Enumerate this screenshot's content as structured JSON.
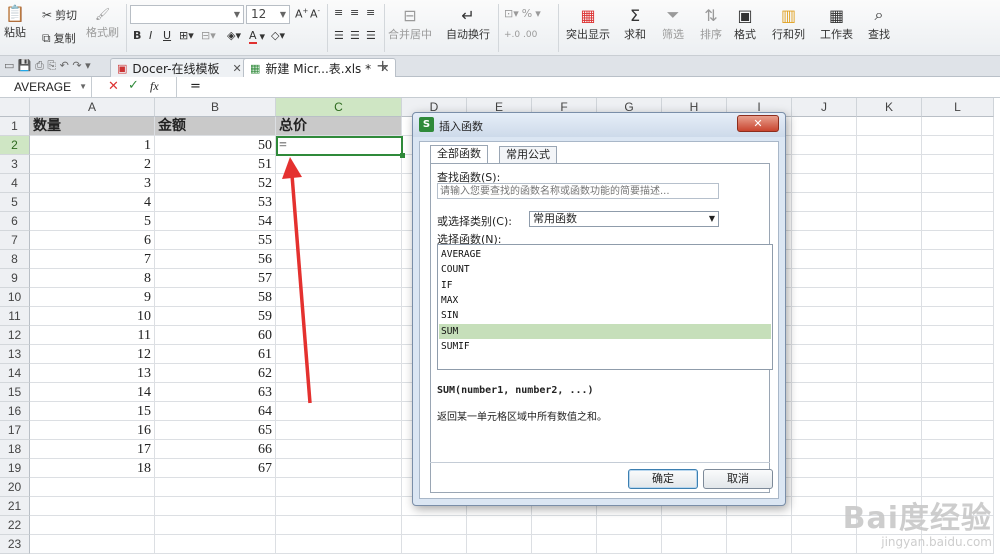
{
  "ribbon": {
    "paste": "粘贴",
    "cut": "剪切",
    "copy": "复制",
    "format_painter": "格式刷",
    "font_size": "12",
    "merge_center": "合并居中",
    "wrap_text": "自动换行",
    "percent": "%",
    "highlight": "突出显示",
    "sum": "求和",
    "filter": "筛选",
    "sort": "排序",
    "format": "格式",
    "row_col": "行和列",
    "worksheet": "工作表",
    "find": "查找"
  },
  "tabs": [
    {
      "label": "Docer-在线模板"
    },
    {
      "label": "新建 Micr...表.xls *"
    }
  ],
  "formula_bar": {
    "name_box": "AVERAGE",
    "fx": "fx",
    "content": "="
  },
  "sheet": {
    "columns": [
      "A",
      "B",
      "C",
      "D",
      "E",
      "F",
      "G",
      "H",
      "I",
      "J",
      "K",
      "L"
    ],
    "rows": [
      "1",
      "2",
      "3",
      "4",
      "5",
      "6",
      "7",
      "8",
      "9",
      "10",
      "11",
      "12",
      "13",
      "14",
      "15",
      "16",
      "17",
      "18",
      "19",
      "20",
      "21",
      "22",
      "23"
    ],
    "headers": {
      "a": "数量",
      "b": "金额",
      "c": "总价"
    },
    "qty": [
      "1",
      "2",
      "3",
      "4",
      "5",
      "6",
      "7",
      "8",
      "9",
      "10",
      "11",
      "12",
      "13",
      "14",
      "15",
      "16",
      "17",
      "18"
    ],
    "amount": [
      "50",
      "51",
      "52",
      "53",
      "54",
      "55",
      "56",
      "57",
      "58",
      "59",
      "60",
      "61",
      "62",
      "63",
      "64",
      "65",
      "66",
      "67"
    ],
    "active_cell_content": "="
  },
  "dialog": {
    "title": "插入函数",
    "tab_all": "全部函数",
    "tab_common": "常用公式",
    "search_label": "查找函数(S):",
    "search_placeholder": "请输入您要查找的函数名称或函数功能的简要描述...",
    "category_label": "或选择类别(C):",
    "category_value": "常用函数",
    "select_label": "选择函数(N):",
    "functions": [
      "AVERAGE",
      "COUNT",
      "IF",
      "MAX",
      "SIN",
      "SUM",
      "SUMIF"
    ],
    "selected_index": 5,
    "signature": "SUM(number1, number2, ...)",
    "description": "返回某一单元格区域中所有数值之和。",
    "ok": "确定",
    "cancel": "取消"
  },
  "watermark": {
    "brand": "Bai度经验",
    "url": "jingyan.baidu.com"
  },
  "colors": {
    "accent_green": "#2f8a3a",
    "arrow_red": "#e4312f",
    "header_gray": "#c9c9c9",
    "selection_green": "#c6dfba"
  }
}
